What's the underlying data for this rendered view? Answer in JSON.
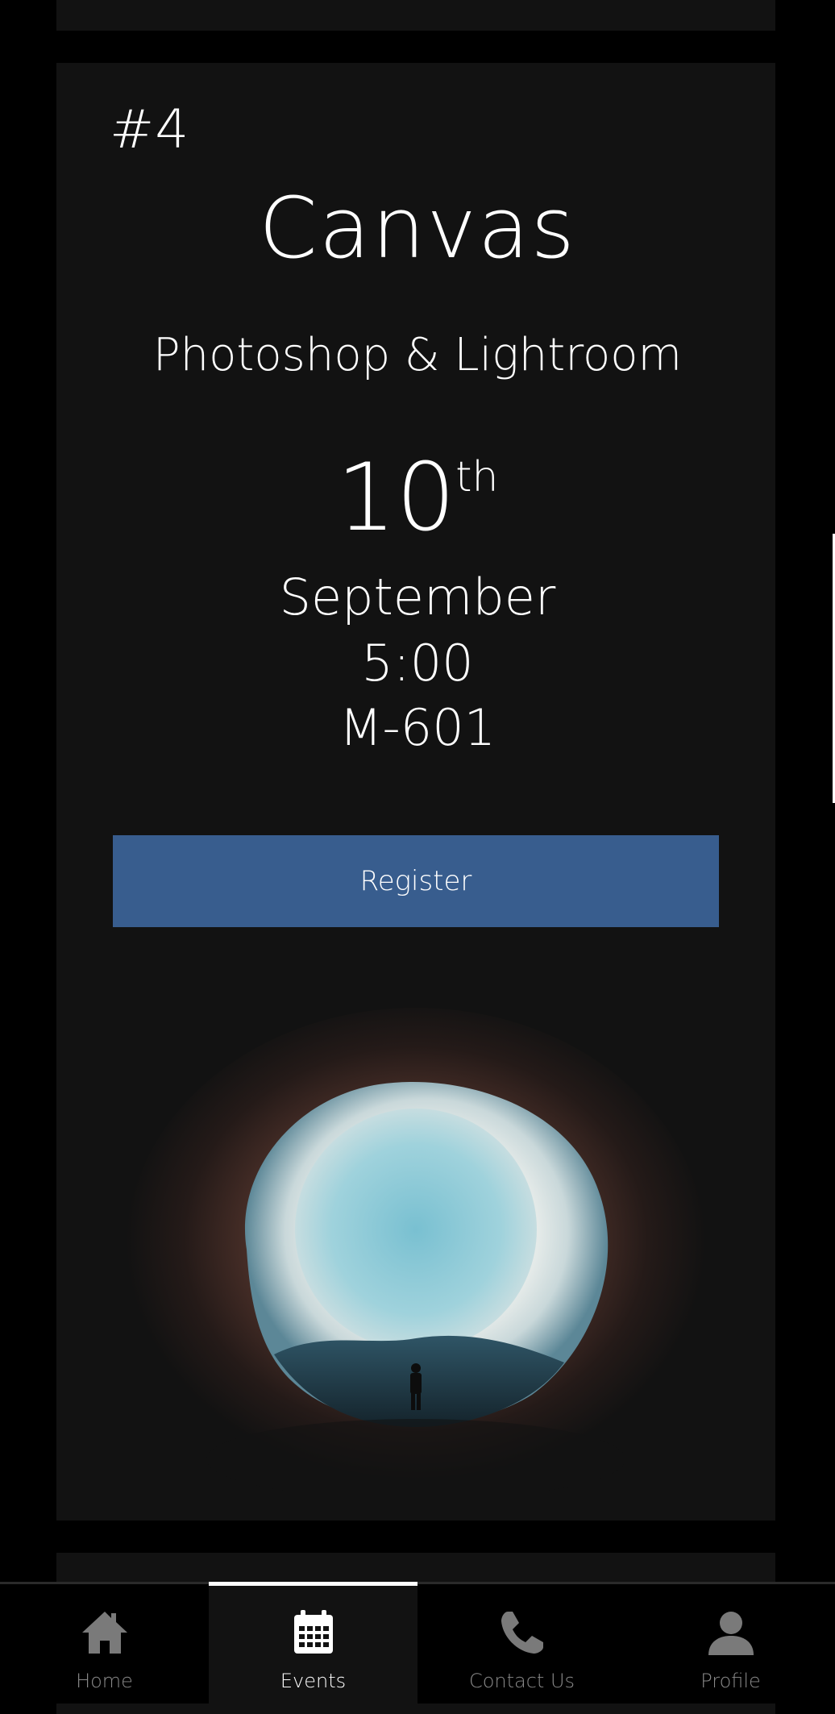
{
  "event": {
    "number": "#4",
    "title": "Canvas",
    "subtitle": "Photoshop & Lightroom",
    "day": "10",
    "day_suffix": "th",
    "month": "September",
    "time": "5:00",
    "room": "M-601",
    "register_label": "Register",
    "accent_color": "#385d8e"
  },
  "nav": {
    "items": [
      {
        "label": "Home",
        "icon": "home-icon"
      },
      {
        "label": "Events",
        "icon": "calendar-icon",
        "active": true
      },
      {
        "label": "Contact Us",
        "icon": "phone-icon"
      },
      {
        "label": "Profile",
        "icon": "user-icon"
      }
    ]
  }
}
